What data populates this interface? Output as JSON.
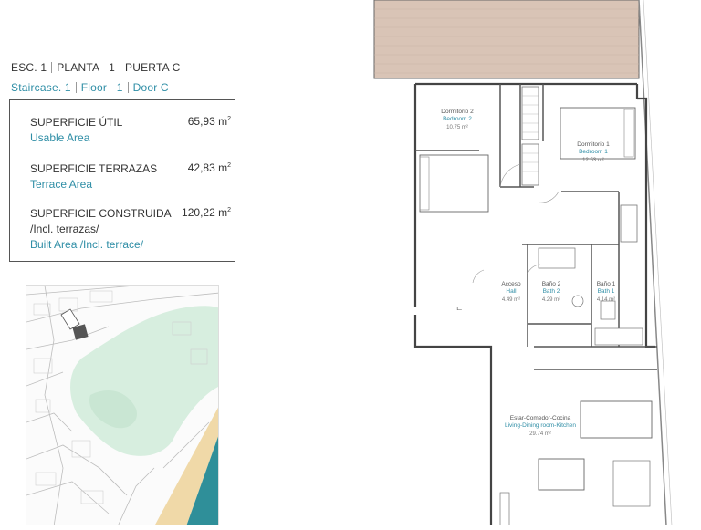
{
  "header": {
    "es": [
      "ESC. 1",
      "PLANTA   1",
      "PUERTA C"
    ],
    "en": [
      "Staircase. 1",
      "Floor   1",
      "Door C"
    ]
  },
  "areas": {
    "usable": {
      "es": "SUPERFICIE ÚTIL",
      "en": "Usable Area",
      "value": "65,93 m",
      "unit_sup": "2"
    },
    "terrace": {
      "es": "SUPERFICIE TERRAZAS",
      "en": "Terrace Area",
      "value": "42,83 m",
      "unit_sup": "2"
    },
    "built": {
      "es": "SUPERFICIE CONSTRUIDA",
      "es2": "/Incl. terrazas/",
      "en": "Built Area /Incl. terrace/",
      "value": "120,22 m",
      "unit_sup": "2"
    }
  },
  "rooms": {
    "bedroom2": {
      "es": "Dormitorio 2",
      "en": "Bedroom 2",
      "area": "10.75 m²"
    },
    "bedroom1": {
      "es": "Dormitorio 1",
      "en": "Bedroom 1",
      "area": "12.53 m²"
    },
    "hall": {
      "es": "Acceso",
      "en": "Hall",
      "area": "4.49 m²"
    },
    "bath2": {
      "es": "Baño 2",
      "en": "Bath 2",
      "area": "4.29 m²"
    },
    "bath1": {
      "es": "Baño 1",
      "en": "Bath 1",
      "area": "4.14 m²"
    },
    "living": {
      "es": "Estar-Comedor-Cocina",
      "en": "Living-Dining room-Kitchen",
      "area": "29.74 m²"
    }
  },
  "colors": {
    "accent": "#2f8ea6",
    "terrace_fill": "#d9c4b6",
    "map_green": "#d7eedf",
    "sea": "#2f8f99",
    "beach": "#f0d9a8"
  }
}
